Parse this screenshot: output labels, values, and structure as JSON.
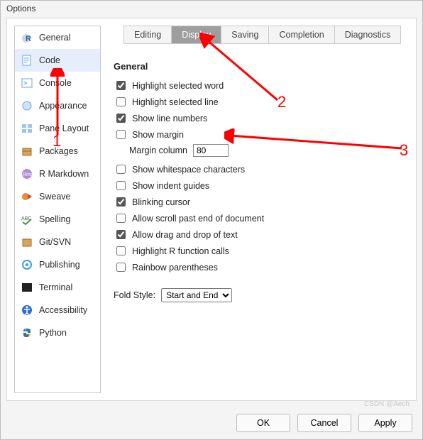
{
  "window": {
    "title": "Options"
  },
  "sidebar": {
    "items": [
      {
        "label": "General"
      },
      {
        "label": "Code"
      },
      {
        "label": "Console"
      },
      {
        "label": "Appearance"
      },
      {
        "label": "Pane Layout"
      },
      {
        "label": "Packages"
      },
      {
        "label": "R Markdown"
      },
      {
        "label": "Sweave"
      },
      {
        "label": "Spelling"
      },
      {
        "label": "Git/SVN"
      },
      {
        "label": "Publishing"
      },
      {
        "label": "Terminal"
      },
      {
        "label": "Accessibility"
      },
      {
        "label": "Python"
      }
    ],
    "selected_index": 1
  },
  "tabs": {
    "items": [
      {
        "label": "Editing"
      },
      {
        "label": "Display"
      },
      {
        "label": "Saving"
      },
      {
        "label": "Completion"
      },
      {
        "label": "Diagnostics"
      }
    ],
    "active_index": 1
  },
  "section": {
    "title": "General"
  },
  "options": {
    "highlight_selected_word": {
      "label": "Highlight selected word",
      "checked": true
    },
    "highlight_selected_line": {
      "label": "Highlight selected line",
      "checked": false
    },
    "show_line_numbers": {
      "label": "Show line numbers",
      "checked": true
    },
    "show_margin": {
      "label": "Show margin",
      "checked": false
    },
    "margin_column": {
      "label": "Margin column",
      "value": "80"
    },
    "show_whitespace": {
      "label": "Show whitespace characters",
      "checked": false
    },
    "show_indent_guides": {
      "label": "Show indent guides",
      "checked": false
    },
    "blinking_cursor": {
      "label": "Blinking cursor",
      "checked": true
    },
    "scroll_past_end": {
      "label": "Allow scroll past end of document",
      "checked": false
    },
    "drag_drop_text": {
      "label": "Allow drag and drop of text",
      "checked": true
    },
    "highlight_r_calls": {
      "label": "Highlight R function calls",
      "checked": false
    },
    "rainbow_parens": {
      "label": "Rainbow parentheses",
      "checked": false
    }
  },
  "fold_style": {
    "label": "Fold Style:",
    "value": "Start and End"
  },
  "buttons": {
    "ok": "OK",
    "cancel": "Cancel",
    "apply": "Apply"
  },
  "annotations": {
    "a1": "1",
    "a2": "2",
    "a3": "3"
  },
  "watermark": "CSDN @Aech"
}
